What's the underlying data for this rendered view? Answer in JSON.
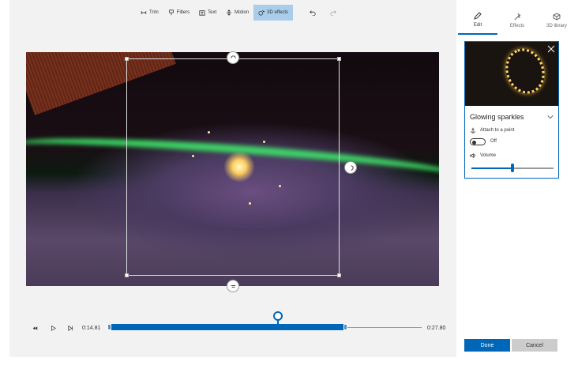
{
  "toolbar": {
    "items": [
      {
        "label": "Trim",
        "icon": "trim-icon"
      },
      {
        "label": "Filters",
        "icon": "filters-icon"
      },
      {
        "label": "Text",
        "icon": "text-icon"
      },
      {
        "label": "Motion",
        "icon": "motion-icon"
      },
      {
        "label": "3D effects",
        "icon": "3d-effects-icon",
        "active": true
      }
    ],
    "undo_icon": "undo-icon",
    "redo_icon": "redo-icon"
  },
  "timeline": {
    "start_time": "0:14.81",
    "end_time": "0:27.80",
    "selection_start_fraction": 0.006,
    "selection_end_fraction": 0.76,
    "playhead_fraction": 0.54
  },
  "panel": {
    "tabs": [
      {
        "label": "Edit",
        "icon": "pencil-icon",
        "active": true
      },
      {
        "label": "Effects",
        "icon": "effects-icon"
      },
      {
        "label": "3D library",
        "icon": "3d-library-icon"
      }
    ],
    "effect": {
      "title": "Glowing sparkles",
      "attach_label": "Attach to a point",
      "toggle_state": "Off",
      "volume_label": "Volume",
      "volume_level": 0.5
    }
  },
  "actions": {
    "done_label": "Done",
    "cancel_label": "Cancel"
  },
  "colors": {
    "accent": "#0067b8",
    "active_tool": "#a9cdea"
  }
}
